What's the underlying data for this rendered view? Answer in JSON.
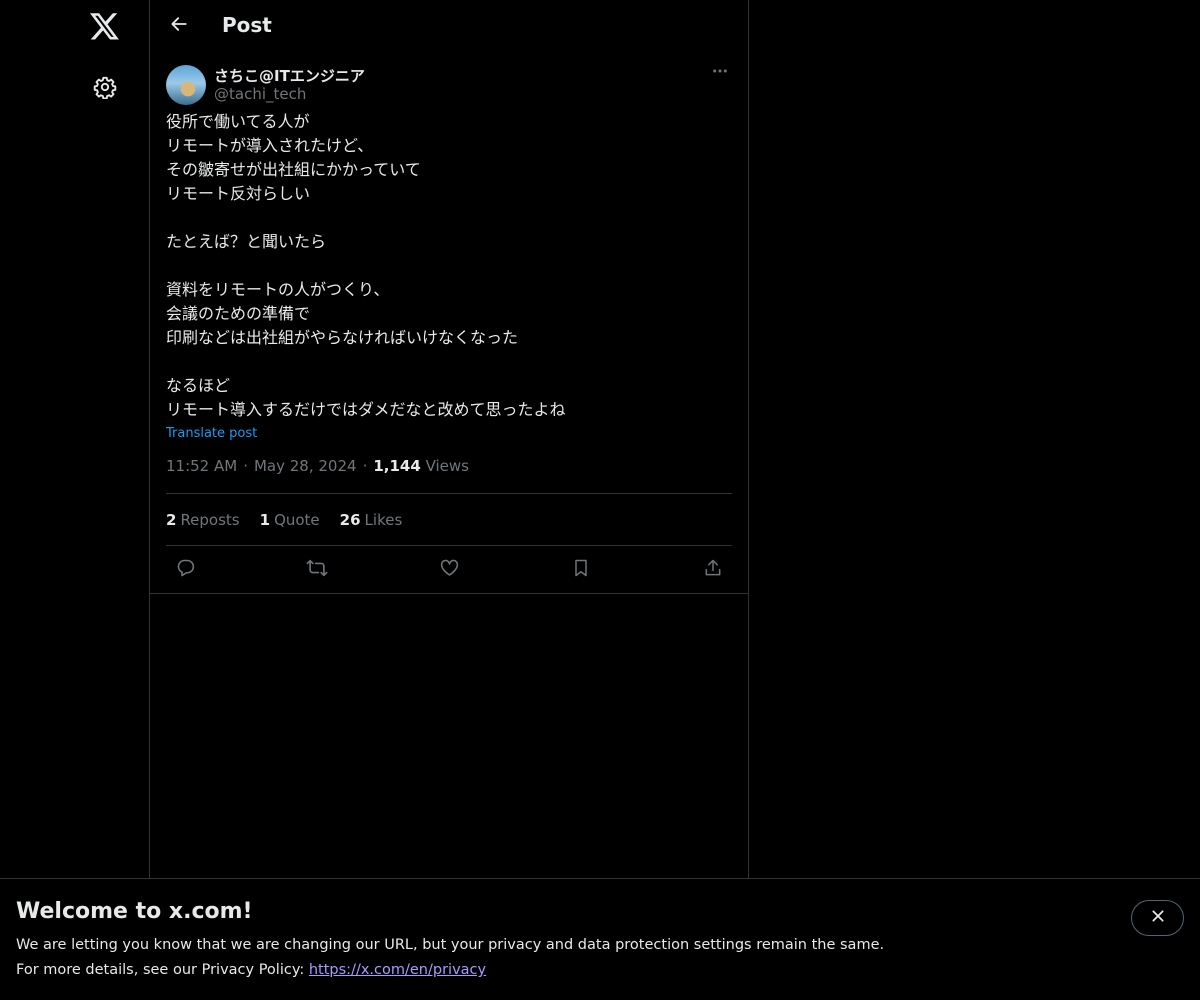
{
  "header": {
    "title": "Post"
  },
  "tweet": {
    "author_name": "さちこ@ITエンジニア",
    "author_handle": "@tachi_tech",
    "text": "役所で働いてる人が\nリモートが導入されたけど、\nその皺寄せが出社組にかかっていて\nリモート反対らしい\n\nたとえば？と聞いたら\n\n資料をリモートの人がつくり、\n会議のための準備で\n印刷などは出社組がやらなければいけなくなった\n\nなるほど\nリモート導入するだけではダメだなと改めて思ったよね",
    "translate_label": "Translate post",
    "time": "11:52 AM",
    "date": "May 28, 2024",
    "views_count": "1,144",
    "views_label": "Views",
    "separator": "·"
  },
  "stats": {
    "reposts_count": "2",
    "reposts_label": "Reposts",
    "quote_count": "1",
    "quote_label": "Quote",
    "likes_count": "26",
    "likes_label": "Likes"
  },
  "icons": {
    "logo": "x-logo-icon",
    "settings": "gear-icon",
    "back": "arrow-left-icon",
    "more": "more-horizontal-icon",
    "reply": "reply-icon",
    "repost": "repost-icon",
    "like": "heart-icon",
    "bookmark": "bookmark-icon",
    "share": "share-icon",
    "close": "close-icon"
  },
  "banner": {
    "title": "Welcome to x.com!",
    "line1": "We are letting you know that we are changing our URL, but your privacy and data protection settings remain the same.",
    "line2_prefix": "For more details, see our Privacy Policy: ",
    "link_text": "https://x.com/en/privacy"
  },
  "colors": {
    "background": "#000000",
    "text_primary": "#e7e9ea",
    "text_secondary": "#71767b",
    "accent": "#1d9bf0",
    "border": "#2f3336",
    "banner_link": "#a89bff"
  }
}
